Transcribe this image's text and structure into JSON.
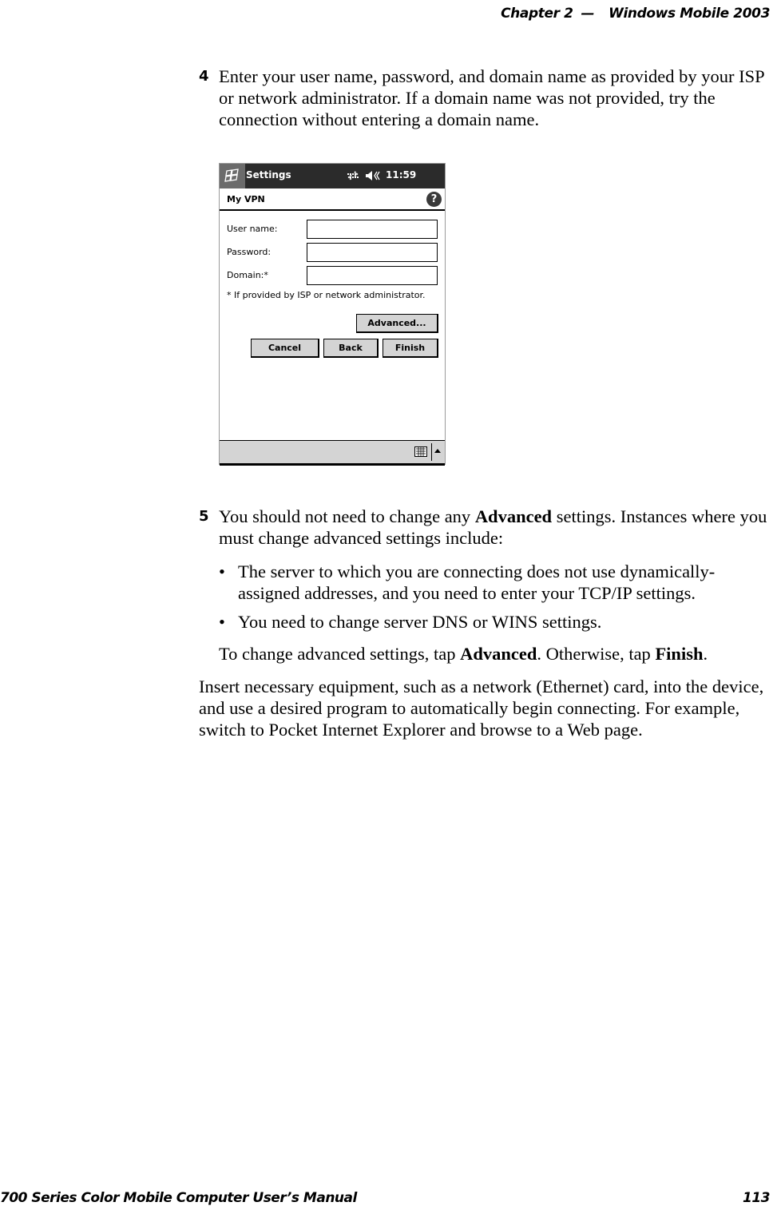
{
  "header": {
    "chapter": "Chapter  2",
    "dash": "—",
    "title": "Windows Mobile 2003"
  },
  "step4": {
    "number": "4",
    "text": "Enter your user name, password, and domain name as provided by your ISP or network administrator. If a domain name was not provided, try the connection without entering a domain name."
  },
  "screenshot": {
    "app_title": "Settings",
    "clock": "11:59",
    "subtitle": "My VPN",
    "help_symbol": "?",
    "fields": [
      {
        "label": "User name:",
        "value": ""
      },
      {
        "label": "Password:",
        "value": ""
      },
      {
        "label": "Domain:*",
        "value": ""
      }
    ],
    "note": "* If provided by ISP or network administrator.",
    "buttons": {
      "advanced": "Advanced...",
      "cancel": "Cancel",
      "back": "Back",
      "finish": "Finish"
    },
    "icons": [
      "windows-start-icon",
      "connectivity-icon",
      "speaker-icon",
      "help-icon",
      "keyboard-icon",
      "input-menu-arrow-icon"
    ]
  },
  "step5": {
    "number": "5",
    "text_before": "You should not need to change any ",
    "bold1": "Advanced",
    "text_after": " settings. Instances where you must change advanced settings include:"
  },
  "bullets": [
    {
      "dot": "•",
      "text": "The server to which you are connecting does not use dynamically-assigned addresses, and you need to enter your TCP/IP settings."
    },
    {
      "dot": "•",
      "text": "You need to change server DNS or WINS settings."
    }
  ],
  "advanced_line": {
    "t1": "To change advanced settings, tap ",
    "b1": "Advanced",
    "t2": ". Otherwise, tap ",
    "b2": "Finish",
    "t3": "."
  },
  "closing_paragraph": "Insert necessary equipment, such as a network (Ethernet) card, into the device, and use a desired program to automatically begin connecting. For example, switch to Pocket Internet Explorer and browse to a Web page.",
  "footer": {
    "manual_title": "700 Series Color Mobile Computer User’s Manual",
    "page_number": "113"
  }
}
